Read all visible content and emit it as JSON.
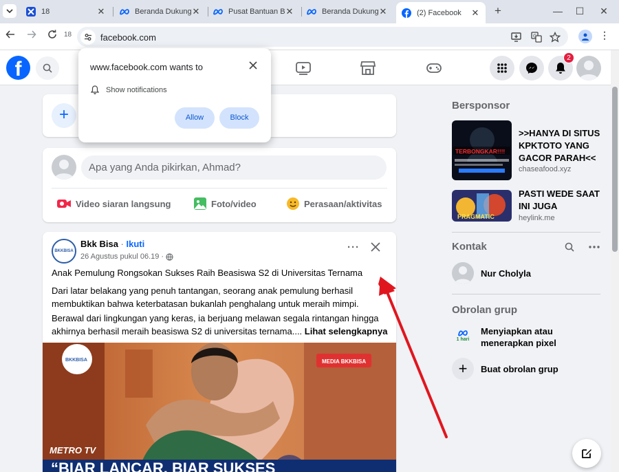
{
  "browser": {
    "tabs": [
      {
        "label": "18",
        "favicon": "app-icon"
      },
      {
        "label": "Beranda Dukung",
        "favicon": "meta-icon"
      },
      {
        "label": "Pusat Bantuan B",
        "favicon": "meta-icon"
      },
      {
        "label": "Beranda Dukung",
        "favicon": "meta-icon"
      },
      {
        "label": "(2) Facebook",
        "favicon": "facebook-icon",
        "active": true
      }
    ],
    "tab_count": "18",
    "url": "facebook.com"
  },
  "permission_prompt": {
    "title": "www.facebook.com wants to",
    "permission": "Show notifications",
    "allow_label": "Allow",
    "block_label": "Block"
  },
  "fb_header": {
    "notification_count": "2"
  },
  "composer": {
    "placeholder": "Apa yang Anda pikirkan, Ahmad?",
    "actions": [
      "Video siaran langsung",
      "Foto/video",
      "Perasaan/aktivitas"
    ]
  },
  "post": {
    "author": "Bkk Bisa",
    "separator": "·",
    "follow_label": "Ikuti",
    "timestamp": "26 Agustus pukul 06.19 ·",
    "logo_text": "BKKBISA",
    "more_label": "···",
    "title": "Anak Pemulung Rongsokan Sukses Raih Beasiswa S2 di Universitas Ternama",
    "paragraph1": "Dari latar belakang yang penuh tantangan, seorang anak pemulung berhasil membuktikan bahwa keterbatasan bukanlah penghalang untuk meraih mimpi.",
    "paragraph2": "Berawal dari lingkungan yang keras, ia berjuang melawan segala rintangan hingga akhirnya berhasil meraih beasiswa S2 di universitas ternama.... ",
    "see_more": "Lihat selengkapnya",
    "image": {
      "brand": "BKKBISA",
      "tag": "MEDIA BKKBISA",
      "channel": "METRO TV",
      "caption": "“BIAR LANCAR, BIAR SUKSES"
    }
  },
  "right_rail": {
    "sponsored_heading": "Bersponsor",
    "ads": [
      {
        "title": ">>HANYA DI SITUS KPKTOTO YANG GACOR PARAH<<",
        "domain": "chaseafood.xyz",
        "image_text": "TERBONGKAR!!!!"
      },
      {
        "title": "PASTI WEDE SAAT INI JUGA",
        "domain": "heylink.me",
        "image_text": "PRAGMATIC"
      }
    ],
    "contacts_heading": "Kontak",
    "contacts": [
      {
        "name": "Nur Cholyla"
      }
    ],
    "group_heading": "Obrolan grup",
    "groups": [
      {
        "name": "Menyiapkan atau menerapkan pixel",
        "badge": "1 hari"
      }
    ],
    "create_group_label": "Buat obrolan grup"
  },
  "colors": {
    "facebook_blue": "#0866ff",
    "annotation_arrow": "#e0161f",
    "notification_badge": "#e41e3f"
  }
}
